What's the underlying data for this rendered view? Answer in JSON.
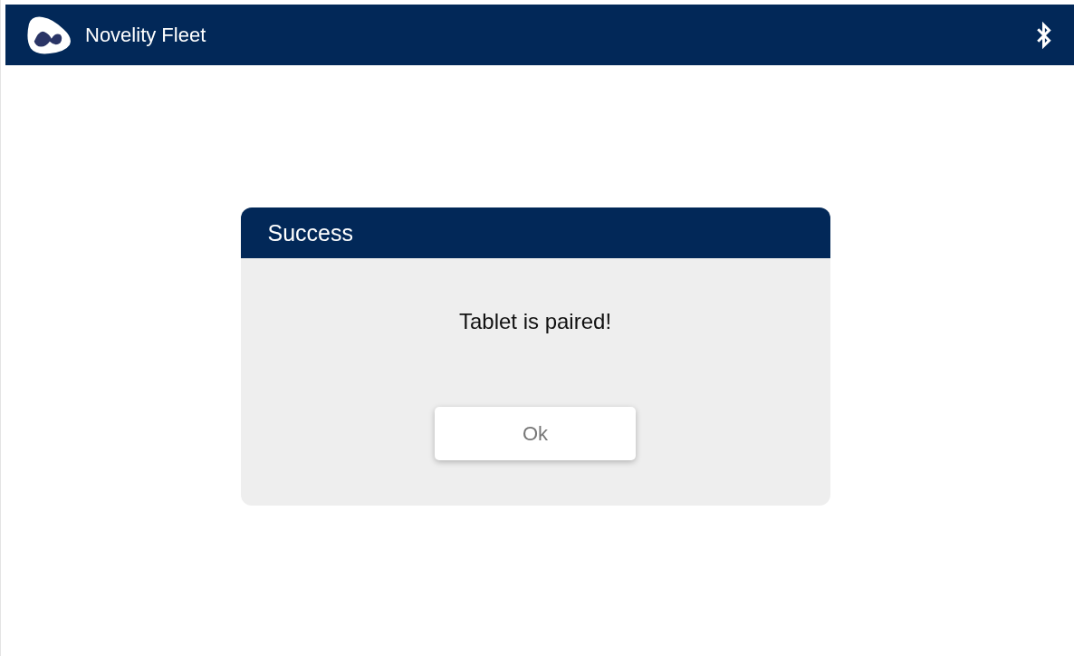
{
  "app_bar": {
    "title": "Novelity Fleet"
  },
  "dialog": {
    "title": "Success",
    "message": "Tablet is paired!",
    "buttons": [
      "Ok"
    ]
  }
}
